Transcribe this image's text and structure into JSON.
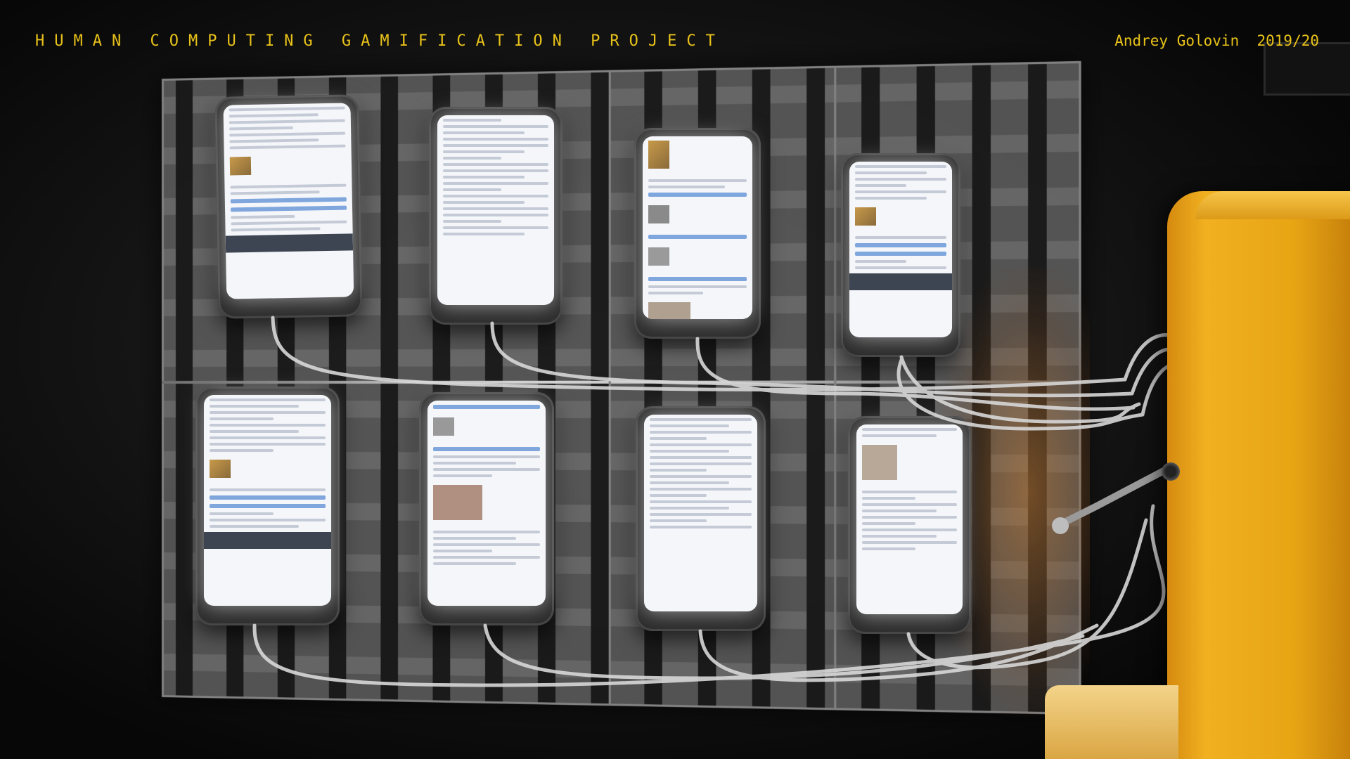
{
  "header": {
    "title": "HUMAN COMPUTING GAMIFICATION PROJECT",
    "credit": "Andrey Golovin  2019/20"
  },
  "colors": {
    "accent_text": "#e8c21a",
    "robot_yellow": "#e7a514",
    "screen_glow": "#f4f6fa",
    "rack_metal": "#5a5a5a"
  }
}
